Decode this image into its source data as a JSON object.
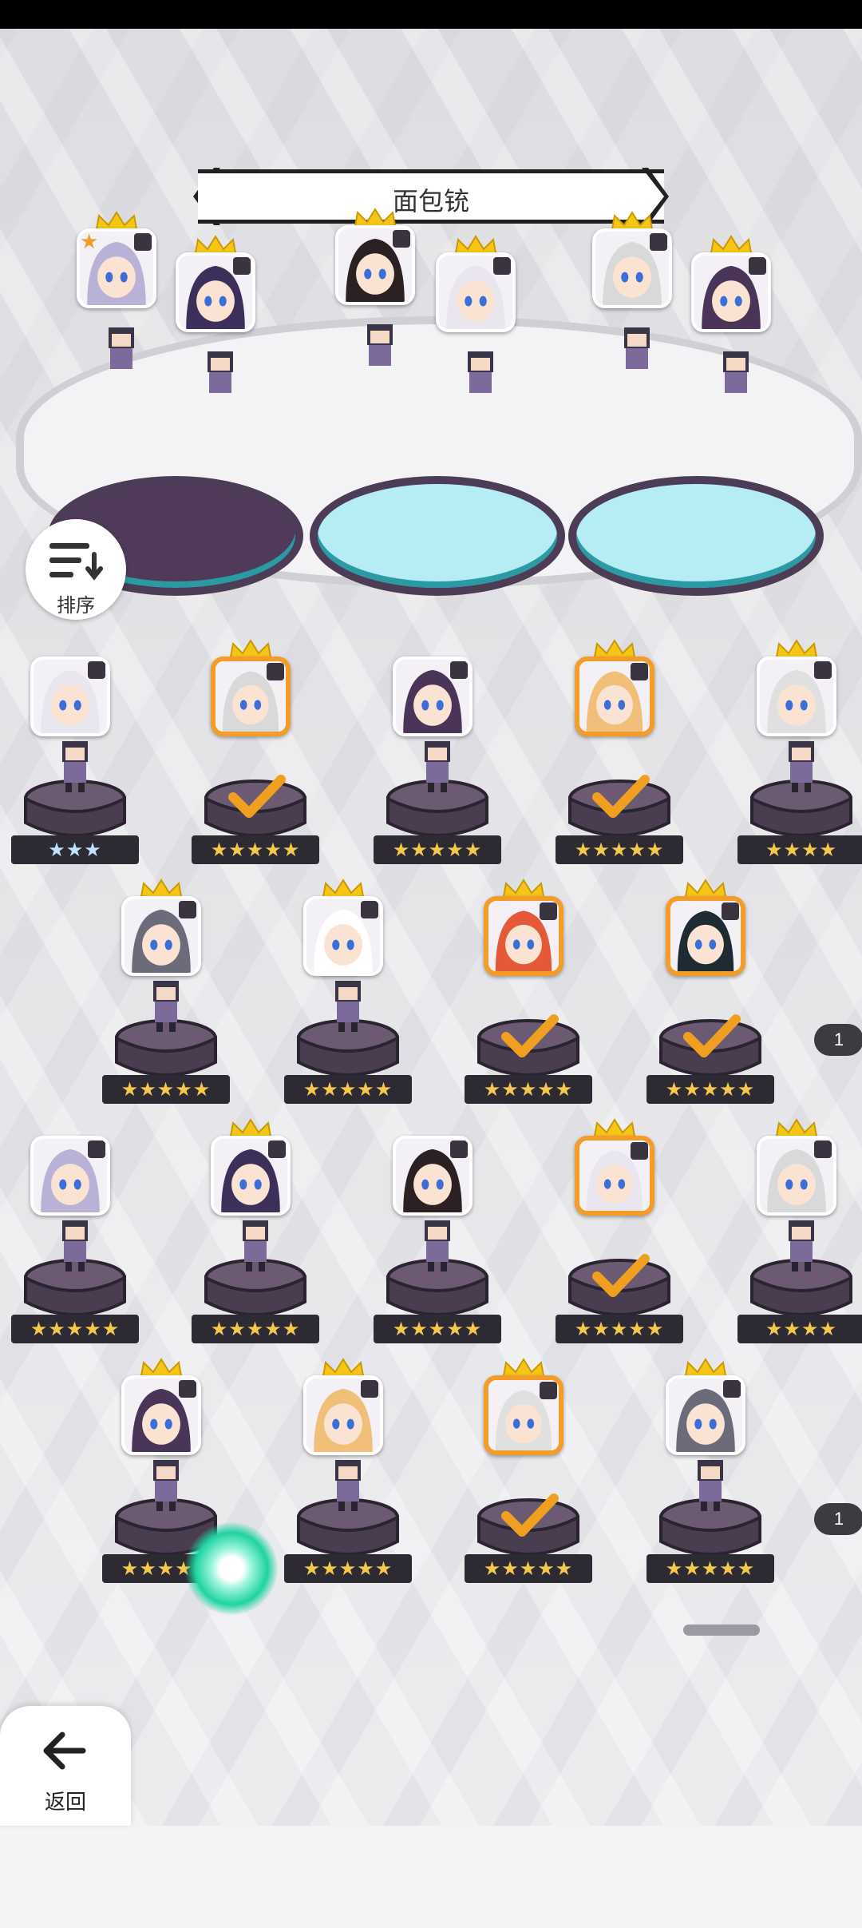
{
  "header": {
    "title": "面包铳"
  },
  "sort": {
    "label": "排序"
  },
  "navigation": {
    "back_label": "返回"
  },
  "colors": {
    "selected_border": "#f39c2a",
    "crown": "#f5c518",
    "star": "#f2c94c",
    "pedestal": "#5b4b60",
    "accent_glow": "#1fd3a2"
  },
  "stage_slots": [
    {
      "rank": "★",
      "stars": ""
    },
    {
      "rank": "",
      "stars": ""
    },
    {
      "rank": "",
      "stars": ""
    },
    {
      "rank": "",
      "stars": ""
    },
    {
      "rank": "",
      "stars": ""
    },
    {
      "rank": "",
      "stars": ""
    }
  ],
  "grid": {
    "rows": [
      [
        {
          "stars": "★★★",
          "selected": false,
          "crown": false,
          "light": true
        },
        {
          "stars": "★★★★★",
          "selected": true,
          "crown": true
        },
        {
          "stars": "★★★★★",
          "selected": false,
          "crown": false
        },
        {
          "stars": "★★★★★",
          "selected": true,
          "crown": true
        },
        {
          "stars": "★★★★",
          "selected": false,
          "crown": true
        }
      ],
      [
        {
          "stars": "★★★★★",
          "selected": false,
          "crown": true
        },
        {
          "stars": "★★★★★",
          "selected": false,
          "crown": true
        },
        {
          "stars": "★★★★★",
          "selected": true,
          "crown": true
        },
        {
          "stars": "★★★★★",
          "selected": true,
          "crown": true
        }
      ],
      [
        {
          "stars": "★★★★★",
          "selected": false,
          "crown": false
        },
        {
          "stars": "★★★★★",
          "selected": false,
          "crown": true
        },
        {
          "stars": "★★★★★",
          "selected": false,
          "crown": false
        },
        {
          "stars": "★★★★★",
          "selected": true,
          "crown": true
        },
        {
          "stars": "★★★★",
          "selected": false,
          "crown": true
        }
      ],
      [
        {
          "stars": "★★★★★",
          "selected": false,
          "crown": true
        },
        {
          "stars": "★★★★★",
          "selected": false,
          "crown": true
        },
        {
          "stars": "★★★★★",
          "selected": true,
          "crown": true
        },
        {
          "stars": "★★★★★",
          "selected": false,
          "crown": true
        }
      ]
    ],
    "edge_counts": [
      "1",
      "1"
    ]
  }
}
